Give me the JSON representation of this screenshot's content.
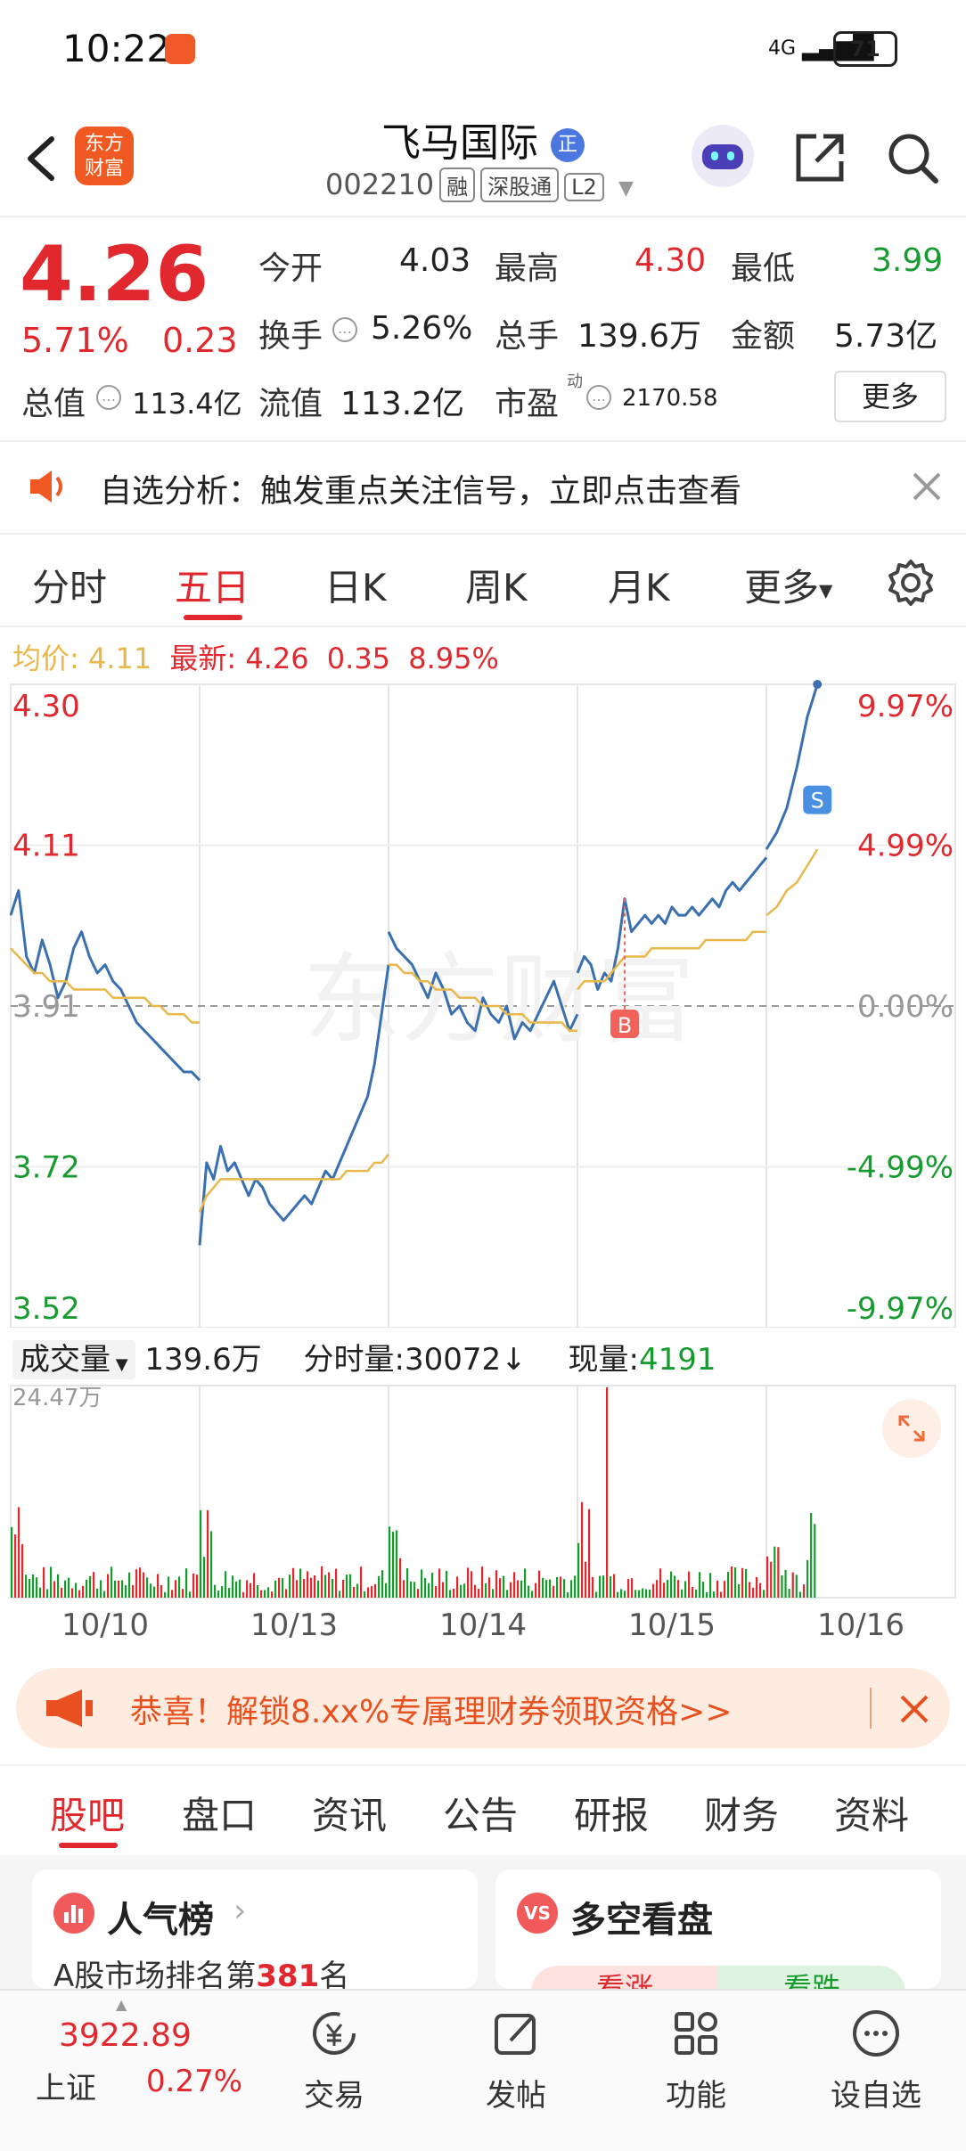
{
  "status_bar": {
    "time": "10:22",
    "network": "4G",
    "battery": "71"
  },
  "header": {
    "app_logo": "东方\n财富",
    "stock_name": "飞马国际",
    "name_badge": "正",
    "stock_code": "002210",
    "tags": [
      "融",
      "深股通",
      "L2"
    ]
  },
  "quote": {
    "price": "4.26",
    "change_pct": "5.71%",
    "change": "0.23",
    "open_label": "今开",
    "open": "4.03",
    "high_label": "最高",
    "high": "4.30",
    "low_label": "最低",
    "low": "3.99",
    "turnover_label": "换手",
    "turnover": "5.26%",
    "volume_label": "总手",
    "volume": "139.6万",
    "amount_label": "金额",
    "amount": "5.73亿",
    "mktcap_label": "总值",
    "mktcap": "113.4亿",
    "float_label": "流值",
    "float": "113.2亿",
    "pe_label": "市盈",
    "pe_sup": "动",
    "pe": "2170.58",
    "more_button": "更多"
  },
  "notice": {
    "text": "自选分析：触发重点关注信号，立即点击查看"
  },
  "chart_tabs": [
    "分时",
    "五日",
    "日K",
    "周K",
    "月K",
    "更多"
  ],
  "active_tab": 1,
  "legend": {
    "avg_label": "均价:",
    "avg": "4.11",
    "latest_label": "最新:",
    "latest": "4.26",
    "latest_chg": "0.35",
    "latest_pct": "8.95%"
  },
  "volume_bar": {
    "label": "成交量",
    "total": "139.6万",
    "tick_label": "分时量:",
    "tick": "30072",
    "now_label": "现量:",
    "now": "4191",
    "max_label": "24.47万"
  },
  "chart_data": {
    "type": "line",
    "y_left_ticks": [
      "4.30",
      "4.11",
      "3.91",
      "3.72",
      "3.52"
    ],
    "y_right_ticks": [
      "9.97%",
      "4.99%",
      "0.00%",
      "-4.99%",
      "-9.97%"
    ],
    "ylim": [
      3.52,
      4.3
    ],
    "prev_close": 3.91,
    "x_labels": [
      "10/10",
      "10/13",
      "10/14",
      "10/15",
      "10/16"
    ],
    "markers": [
      {
        "label": "B",
        "color": "#f0625a"
      },
      {
        "label": "S",
        "color": "#4a90e2"
      }
    ],
    "series": [
      {
        "name": "",
        "color": "#3a6fb0",
        "days": [
          [
            4.02,
            4.05,
            3.97,
            3.95,
            3.99,
            3.96,
            3.92,
            3.94,
            3.98,
            4.0,
            3.97,
            3.95,
            3.96,
            3.94,
            3.93,
            3.91,
            3.89,
            3.88,
            3.87,
            3.86,
            3.85,
            3.84,
            3.83,
            3.83,
            3.82
          ],
          [
            3.62,
            3.72,
            3.7,
            3.74,
            3.71,
            3.72,
            3.7,
            3.68,
            3.7,
            3.69,
            3.67,
            3.66,
            3.65,
            3.66,
            3.67,
            3.68,
            3.67,
            3.69,
            3.71,
            3.7,
            3.72,
            3.74,
            3.76,
            3.78,
            3.8,
            3.84,
            3.9,
            3.96
          ],
          [
            4.0,
            3.98,
            3.97,
            3.96,
            3.94,
            3.92,
            3.95,
            3.93,
            3.9,
            3.91,
            3.89,
            3.88,
            3.92,
            3.9,
            3.89,
            3.91,
            3.87,
            3.89,
            3.88,
            3.9,
            3.92,
            3.94,
            3.91,
            3.88,
            3.9
          ],
          [
            3.95,
            3.97,
            3.96,
            3.93,
            3.95,
            3.94,
            3.98,
            4.04,
            4.0,
            4.01,
            4.02,
            4.01,
            4.02,
            4.01,
            4.03,
            4.02,
            4.02,
            4.03,
            4.02,
            4.03,
            4.04,
            4.03,
            4.05,
            4.06,
            4.05,
            4.06,
            4.07,
            4.08,
            4.09
          ],
          [
            4.1,
            4.12,
            4.15,
            4.2,
            4.26,
            4.3
          ]
        ]
      },
      {
        "name": "均价",
        "color": "#e8b84a",
        "days": [
          [
            3.98,
            3.97,
            3.96,
            3.95,
            3.95,
            3.94,
            3.94,
            3.94,
            3.93,
            3.93,
            3.93,
            3.93,
            3.93,
            3.92,
            3.92,
            3.92,
            3.92,
            3.92,
            3.91,
            3.91,
            3.9,
            3.9,
            3.9,
            3.89,
            3.89
          ],
          [
            3.66,
            3.68,
            3.69,
            3.7,
            3.7,
            3.7,
            3.7,
            3.7,
            3.7,
            3.7,
            3.7,
            3.7,
            3.7,
            3.7,
            3.7,
            3.7,
            3.7,
            3.7,
            3.7,
            3.7,
            3.7,
            3.71,
            3.71,
            3.71,
            3.71,
            3.72,
            3.72,
            3.73
          ],
          [
            3.96,
            3.96,
            3.95,
            3.95,
            3.94,
            3.94,
            3.93,
            3.93,
            3.93,
            3.92,
            3.92,
            3.92,
            3.91,
            3.91,
            3.91,
            3.9,
            3.9,
            3.9,
            3.89,
            3.89,
            3.89,
            3.89,
            3.89,
            3.88,
            3.88
          ],
          [
            3.93,
            3.94,
            3.94,
            3.94,
            3.94,
            3.95,
            3.96,
            3.97,
            3.97,
            3.97,
            3.97,
            3.98,
            3.98,
            3.98,
            3.98,
            3.98,
            3.98,
            3.98,
            3.98,
            3.99,
            3.99,
            3.99,
            3.99,
            3.99,
            3.99,
            3.99,
            4.0,
            4.0,
            4.0
          ],
          [
            4.02,
            4.03,
            4.05,
            4.06,
            4.08,
            4.1
          ]
        ]
      }
    ]
  },
  "promo": {
    "text": "恭喜！解锁8.xx%专属理财券领取资格>>"
  },
  "section_tabs": [
    "股吧",
    "盘口",
    "资讯",
    "公告",
    "研报",
    "财务",
    "资料"
  ],
  "cards": {
    "popularity_title": "人气榜",
    "popularity_text": "A股市场排名第",
    "popularity_rank": "381",
    "popularity_unit": "名",
    "bullbear_title": "多空看盘",
    "bull": "看涨",
    "bear": "看跌"
  },
  "bottom_nav": {
    "index_value": "3922.89",
    "index_name": "上证",
    "index_pct": "0.27%",
    "items": [
      "交易",
      "发帖",
      "功能",
      "设自选"
    ]
  }
}
